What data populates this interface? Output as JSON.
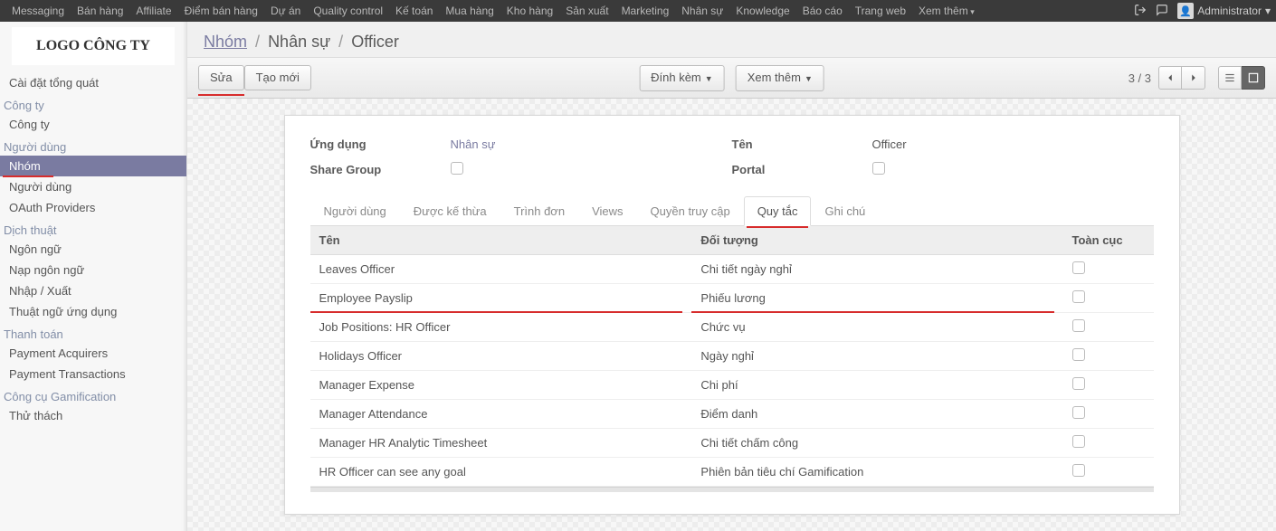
{
  "topbar": {
    "menus": [
      "Messaging",
      "Bán hàng",
      "Affiliate",
      "Điểm bán hàng",
      "Dự án",
      "Quality control",
      "Kế toán",
      "Mua hàng",
      "Kho hàng",
      "Sản xuất",
      "Marketing",
      "Nhân sự",
      "Knowledge",
      "Báo cáo",
      "Trang web",
      "Xem thêm"
    ],
    "user": "Administrator"
  },
  "logo_text": "LOGO CÔNG TY",
  "sidebar": [
    {
      "type": "item",
      "label": "Cài đặt tổng quát"
    },
    {
      "type": "section",
      "label": "Công ty"
    },
    {
      "type": "item",
      "label": "Công ty"
    },
    {
      "type": "section",
      "label": "Người dùng"
    },
    {
      "type": "item",
      "label": "Nhóm",
      "active": true,
      "red": true
    },
    {
      "type": "item",
      "label": "Người dùng"
    },
    {
      "type": "item",
      "label": "OAuth Providers"
    },
    {
      "type": "section",
      "label": "Dịch thuật"
    },
    {
      "type": "item",
      "label": "Ngôn ngữ"
    },
    {
      "type": "item",
      "label": "Nạp ngôn ngữ"
    },
    {
      "type": "item",
      "label": "Nhập / Xuất"
    },
    {
      "type": "item",
      "label": "Thuật ngữ ứng dụng"
    },
    {
      "type": "section",
      "label": "Thanh toán"
    },
    {
      "type": "item",
      "label": "Payment Acquirers"
    },
    {
      "type": "item",
      "label": "Payment Transactions"
    },
    {
      "type": "section",
      "label": "Công cụ Gamification"
    },
    {
      "type": "item",
      "label": "Thử thách"
    }
  ],
  "crumbs": {
    "root": "Nhóm",
    "mid": "Nhân sự",
    "leaf": "Officer"
  },
  "buttons": {
    "edit": "Sửa",
    "create": "Tạo mới",
    "attach": "Đính kèm",
    "more": "Xem thêm"
  },
  "pager": "3 / 3",
  "form": {
    "app_label": "Ứng dụng",
    "app_value": "Nhân sự",
    "share_label": "Share Group",
    "name_label": "Tên",
    "name_value": "Officer",
    "portal_label": "Portal"
  },
  "tabs": [
    "Người dùng",
    "Được kế thừa",
    "Trình đơn",
    "Views",
    "Quyền truy cập",
    "Quy tắc",
    "Ghi chú"
  ],
  "active_tab": 5,
  "table": {
    "headers": {
      "name": "Tên",
      "object": "Đối tượng",
      "global": "Toàn cục"
    },
    "rows": [
      {
        "name": "Leaves Officer",
        "object": "Chi tiết ngày nghỉ",
        "global": false
      },
      {
        "name": "Employee Payslip",
        "object": "Phiếu lương",
        "global": false,
        "red": true
      },
      {
        "name": "Job Positions: HR Officer",
        "object": "Chức vụ",
        "global": false
      },
      {
        "name": "Holidays Officer",
        "object": "Ngày nghỉ",
        "global": false
      },
      {
        "name": "Manager Expense",
        "object": "Chi phí",
        "global": false
      },
      {
        "name": "Manager Attendance",
        "object": "Điểm danh",
        "global": false
      },
      {
        "name": "Manager HR Analytic Timesheet",
        "object": "Chi tiết chấm công",
        "global": false
      },
      {
        "name": "HR Officer can see any goal",
        "object": "Phiên bản tiêu chí Gamification",
        "global": false
      }
    ]
  }
}
